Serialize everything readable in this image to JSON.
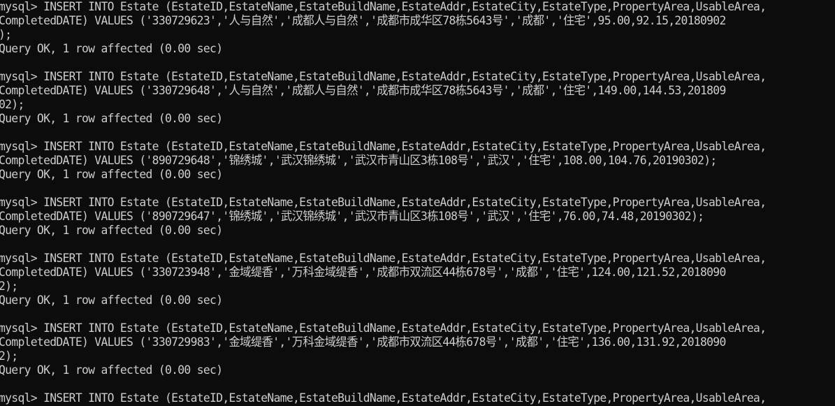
{
  "theme": {
    "background": "#0c0c0c",
    "foreground": "#cccccc"
  },
  "terminal": {
    "lines": [
      "mysql> INSERT INTO Estate (EstateID,EstateName,EstateBuildName,EstateAddr,EstateCity,EstateType,PropertyArea,UsableArea,",
      "CompletedDATE) VALUES ('330729623','人与自然','成都人与自然','成都市成华区78栋5643号','成都','住宅',95.00,92.15,20180902",
      ");",
      "Query OK, 1 row affected (0.00 sec)",
      "",
      "mysql> INSERT INTO Estate (EstateID,EstateName,EstateBuildName,EstateAddr,EstateCity,EstateType,PropertyArea,UsableArea,",
      "CompletedDATE) VALUES ('330729648','人与自然','成都人与自然','成都市成华区78栋5643号','成都','住宅',149.00,144.53,201809",
      "02);",
      "Query OK, 1 row affected (0.00 sec)",
      "",
      "mysql> INSERT INTO Estate (EstateID,EstateName,EstateBuildName,EstateAddr,EstateCity,EstateType,PropertyArea,UsableArea,",
      "CompletedDATE) VALUES ('890729648','锦绣城','武汉锦绣城','武汉市青山区3栋108号','武汉','住宅',108.00,104.76,20190302);",
      "Query OK, 1 row affected (0.00 sec)",
      "",
      "mysql> INSERT INTO Estate (EstateID,EstateName,EstateBuildName,EstateAddr,EstateCity,EstateType,PropertyArea,UsableArea,",
      "CompletedDATE) VALUES ('890729647','锦绣城','武汉锦绣城','武汉市青山区3栋108号','武汉','住宅',76.00,74.48,20190302);",
      "Query OK, 1 row affected (0.00 sec)",
      "",
      "mysql> INSERT INTO Estate (EstateID,EstateName,EstateBuildName,EstateAddr,EstateCity,EstateType,PropertyArea,UsableArea,",
      "CompletedDATE) VALUES ('330723948','金域缇香','万科金域缇香','成都市双流区44栋678号','成都','住宅',124.00,121.52,2018090",
      "2);",
      "Query OK, 1 row affected (0.00 sec)",
      "",
      "mysql> INSERT INTO Estate (EstateID,EstateName,EstateBuildName,EstateAddr,EstateCity,EstateType,PropertyArea,UsableArea,",
      "CompletedDATE) VALUES ('330729983','金域缇香','万科金域缇香','成都市双流区44栋678号','成都','住宅',136.00,131.92,2018090",
      "2);",
      "Query OK, 1 row affected (0.00 sec)",
      "",
      "mysql> INSERT INTO Estate (EstateID,EstateName,EstateBuildName,EstateAddr,EstateCity,EstateType,PropertyArea,UsableArea,"
    ]
  }
}
